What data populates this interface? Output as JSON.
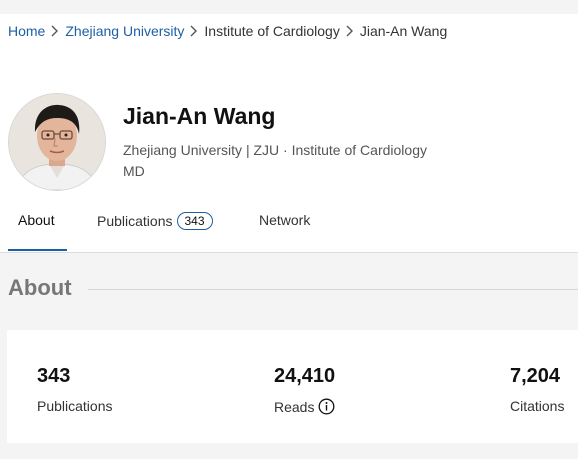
{
  "breadcrumb": {
    "home": "Home",
    "university": "Zhejiang University",
    "department": "Institute of Cardiology",
    "current": "Jian-An Wang"
  },
  "profile": {
    "name": "Jian-An Wang",
    "affiliation": "Zhejiang University | ZJU · Institute of Cardiology",
    "degree": "MD",
    "avatar_icon": "profile-photo"
  },
  "tabs": [
    {
      "label": "About",
      "active": true
    },
    {
      "label": "Publications",
      "count": "343"
    },
    {
      "label": "Network"
    }
  ],
  "about": {
    "title": "About"
  },
  "stats": [
    {
      "value": "343",
      "label": "Publications"
    },
    {
      "value": "24,410",
      "label": "Reads",
      "icon": "info-icon"
    },
    {
      "value": "7,204",
      "label": "Citations"
    }
  ],
  "colors": {
    "link": "#1d5fa7",
    "accent": "#1d5fa7",
    "background": "#f4f4f4",
    "card": "#ffffff"
  }
}
